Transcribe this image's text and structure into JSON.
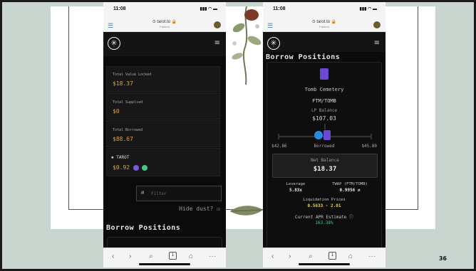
{
  "slide": {
    "number": "36"
  },
  "phones": [
    {
      "status": {
        "time": "11:08",
        "icons": "▮▮▮ ◠ ▬"
      },
      "browser": {
        "domain": "⊙ tarot.to 🔒",
        "subtitle": "Fantom"
      },
      "stats": [
        {
          "label": "Total Value Locked",
          "value": "$18.37"
        },
        {
          "label": "Total Supplied",
          "value": "$0"
        },
        {
          "label": "Total Borrowed",
          "value": "$88.67"
        }
      ],
      "tarot": {
        "label": "TAROT",
        "value": "$0.92"
      },
      "filter_placeholder": "Filter",
      "hide_dust_label": "Hide dust?",
      "hide_dust_icon": "☑",
      "section_title": "Borrow Positions",
      "tab_count": "1"
    },
    {
      "status": {
        "time": "11:08",
        "icons": "▮▮▮ ◠ ▬"
      },
      "browser": {
        "domain": "⊙ tarot.to 🔒",
        "subtitle": "Fantom"
      },
      "section_title": "Borrow Positions",
      "pool": {
        "name": "Tomb Cemetery",
        "pair": "FTM/TOMB",
        "lp_label": "LP Balance",
        "lp_value": "$107.03",
        "borrowed_left": "$42.86",
        "borrowed_label": "Borrowed",
        "borrowed_right": "$45.80",
        "net_label": "Net Balance",
        "net_value": "$18.37",
        "leverage_label": "Leverage",
        "leverage_value": "5.83x",
        "twap_label": "TWAP (FTM/TOMB)",
        "twap_value": "0.9956 ⇄",
        "liq_label": "Liquidation Prices",
        "liq_value": "0.5633 - 2.01",
        "apr_label": "Current APR Estimate",
        "apr_info_icon": "ⓘ",
        "apr_value": "163.38%"
      },
      "tab_count": "1"
    }
  ],
  "nav": {
    "back": "‹",
    "forward": "›",
    "search": "⌕",
    "home": "⌂",
    "more": "···"
  },
  "colors": {
    "gold": "#d8a24a",
    "green": "#4cc28a",
    "yellow": "#e8d24a",
    "blue": "#2a7df4",
    "purple": "#7a5ad8"
  }
}
